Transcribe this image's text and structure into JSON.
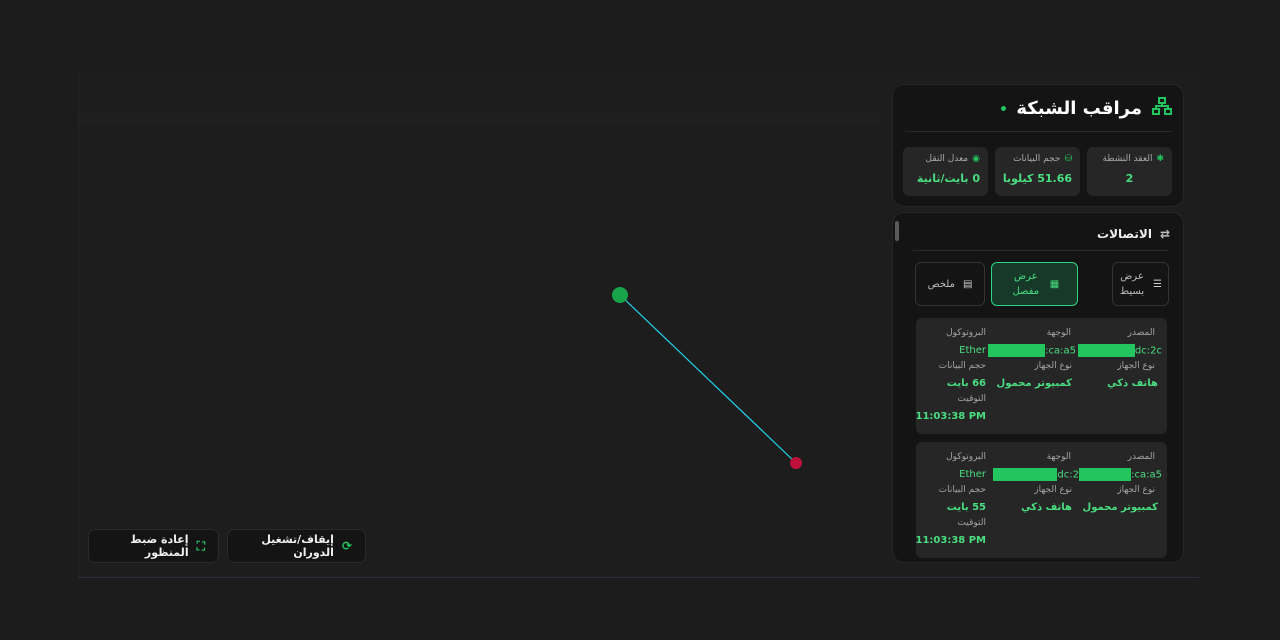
{
  "header": {
    "title": "مراقب الشبكة"
  },
  "stats": [
    {
      "label": "العقد النشطة",
      "value": "2",
      "icon": "nodes-icon"
    },
    {
      "label": "حجم البيانات",
      "value": "51.66 كيلوبايـ",
      "icon": "database-icon"
    },
    {
      "label": "معدل النقل",
      "value": "0 بايت/ثانية",
      "icon": "gauge-icon"
    }
  ],
  "connections": {
    "title": "الاتصالات",
    "views": {
      "simple": "عرض بسيط",
      "detailed": "عرض مفصل",
      "summary": "ملخص"
    },
    "labels": {
      "source": "المصدر",
      "destination": "الوجهة",
      "protocol": "البروتوكول",
      "device_type": "نوع الجهاز",
      "size": "حجم البيانات",
      "time": "التوقيت"
    },
    "items": [
      {
        "source": "dc:2c",
        "destination": "ca:a5:",
        "protocol": "Ether",
        "source_type": "هاتف ذكي",
        "destination_type": "كمبيوتر محمول",
        "size": "66 بايت",
        "time": "11:03:38 PM"
      },
      {
        "source": "ca:a5:",
        "destination": "dc:2",
        "protocol": "Ether",
        "source_type": "كمبيوتر محمول",
        "destination_type": "هاتف ذكي",
        "size": "55 بايت",
        "time": "11:03:38 PM"
      }
    ]
  },
  "controls": {
    "rotate": "إيقاف/تشغيل الدوران",
    "reset": "إعادة ضبط المنظور"
  },
  "colors": {
    "accent": "#22c55e",
    "node_a": "#16a34a",
    "node_b": "#be123c",
    "link": "#22d3ee"
  }
}
